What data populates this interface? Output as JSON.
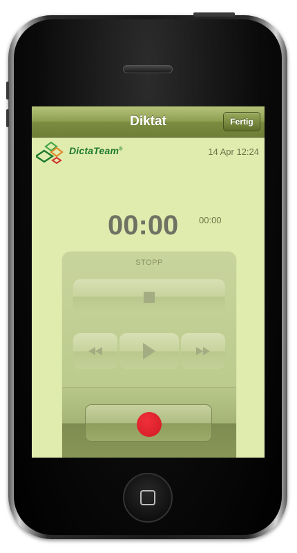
{
  "navbar": {
    "title": "Diktat",
    "done_button": "Fertig"
  },
  "header": {
    "logo_text": "DictaTeam",
    "logo_mark": "®",
    "datetime": "14 Apr 12:24"
  },
  "recorder": {
    "elapsed": "00:00",
    "total": "00:00",
    "status": "STOPP"
  },
  "icons": {
    "stop": "stop-icon",
    "rewind": "rewind-icon",
    "play": "play-icon",
    "fast_forward": "fast-forward-icon",
    "record": "record-icon",
    "home": "home-icon"
  },
  "colors": {
    "screen_bg": "#e0ecae",
    "navbar": "#8f9f51",
    "brand_green": "#1d7a2e",
    "record_red": "#e0222c"
  }
}
